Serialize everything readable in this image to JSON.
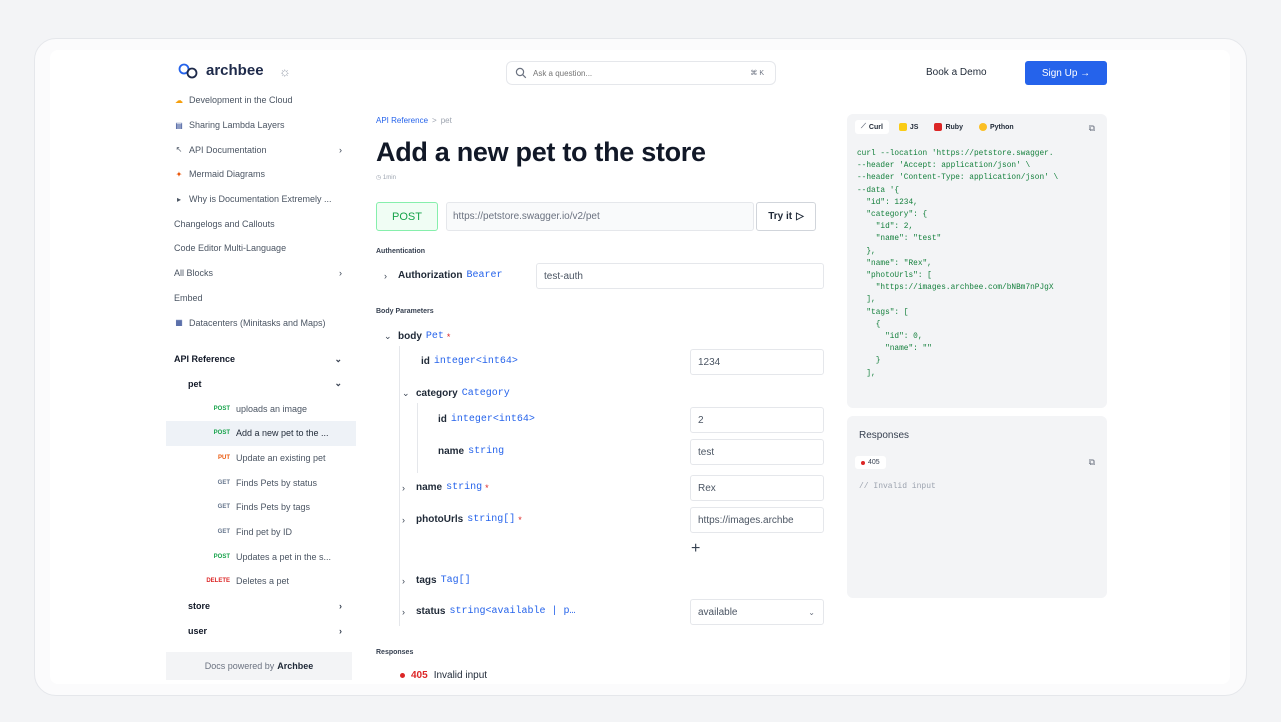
{
  "header": {
    "logo_text": "archbee",
    "search_placeholder": "Ask a question...",
    "search_shortcut": "⌘ K",
    "book_demo": "Book a Demo",
    "sign_up": "Sign Up →"
  },
  "sidebar": {
    "items": [
      {
        "icon": "☁",
        "label": "Development in the Cloud"
      },
      {
        "icon": "▤",
        "label": "Sharing Lambda Layers"
      },
      {
        "icon": "↖",
        "label": "API Documentation",
        "chevron": "›"
      },
      {
        "icon": "✦",
        "label": "Mermaid Diagrams"
      },
      {
        "icon": "▸",
        "label": "Why is Documentation Extremely ..."
      },
      {
        "icon": "",
        "label": "Changelogs and Callouts"
      },
      {
        "icon": "",
        "label": "Code Editor Multi-Language"
      },
      {
        "icon": "",
        "label": "All Blocks",
        "chevron": "›"
      },
      {
        "icon": "",
        "label": "Embed"
      },
      {
        "icon": "▦",
        "label": "Datacenters (Minitasks and Maps)"
      }
    ],
    "section": {
      "label": "API Reference",
      "chevron": "⌄"
    },
    "pet": {
      "label": "pet",
      "chevron": "⌄"
    },
    "endpoints": [
      {
        "method": "POST",
        "label": "uploads an image"
      },
      {
        "method": "POST",
        "label": "Add a new pet to the ..."
      },
      {
        "method": "PUT",
        "label": "Update an existing pet"
      },
      {
        "method": "GET",
        "label": "Finds Pets by status"
      },
      {
        "method": "GET",
        "label": "Finds Pets by tags"
      },
      {
        "method": "GET",
        "label": "Find pet by ID"
      },
      {
        "method": "POST",
        "label": "Updates a pet in the s..."
      },
      {
        "method": "DELETE",
        "label": "Deletes a pet"
      }
    ],
    "store": {
      "label": "store",
      "chevron": "›"
    },
    "user": {
      "label": "user",
      "chevron": "›"
    },
    "powered_prefix": "Docs powered by",
    "powered_brand": "Archbee"
  },
  "main": {
    "breadcrumb_root": "API Reference",
    "breadcrumb_sep": ">",
    "breadcrumb_current": "pet",
    "title": "Add a new pet to the store",
    "read_time": "◷ 1min",
    "method": "POST",
    "url": "https://petstore.swagger.io/v2/pet",
    "try_it": "Try it",
    "authentication_label": "Authentication",
    "auth": {
      "name": "Authorization",
      "type": "Bearer",
      "value": "test-auth"
    },
    "body_params_label": "Body Parameters",
    "body": {
      "name": "body",
      "type": "Pet",
      "required": "*"
    },
    "id": {
      "name": "id",
      "type": "integer<int64>",
      "value": "1234"
    },
    "category": {
      "name": "category",
      "type": "Category"
    },
    "cat_id": {
      "name": "id",
      "type": "integer<int64>",
      "value": "2"
    },
    "cat_name": {
      "name": "name",
      "type": "string",
      "value": "test"
    },
    "pname": {
      "name": "name",
      "type": "string",
      "required": "*",
      "value": "Rex"
    },
    "photo": {
      "name": "photoUrls",
      "type": "string[]",
      "required": "*",
      "value": "https://images.archbe"
    },
    "tags": {
      "name": "tags",
      "type": "Tag[]"
    },
    "status": {
      "name": "status",
      "type": "string<available | p…",
      "value": "available"
    },
    "responses_label": "Responses",
    "response": {
      "code": "405",
      "text": "Invalid input"
    }
  },
  "code_panel": {
    "tabs": [
      {
        "label": "Curl",
        "icon": "curl-icon"
      },
      {
        "label": "JS",
        "icon": "js-icon"
      },
      {
        "label": "Ruby",
        "icon": "ruby-icon"
      },
      {
        "label": "Python",
        "icon": "python-icon"
      }
    ],
    "code": "curl --location 'https://petstore.swagger.\n--header 'Accept: application/json' \\\n--header 'Content-Type: application/json' \\\n--data '{\n  \"id\": 1234,\n  \"category\": {\n    \"id\": 2,\n    \"name\": \"test\"\n  },\n  \"name\": \"Rex\",\n  \"photoUrls\": [\n    \"https://images.archbee.com/bNBm7nPJgX\n  ],\n  \"tags\": [\n    {\n      \"id\": 0,\n      \"name\": \"\"\n    }\n  ],"
  },
  "responses_panel": {
    "title": "Responses",
    "badge": "405",
    "comment": "// Invalid input"
  },
  "colors": {
    "accent": "#2563eb",
    "post": "#16a34a",
    "put": "#ea580c",
    "delete": "#dc2626"
  }
}
